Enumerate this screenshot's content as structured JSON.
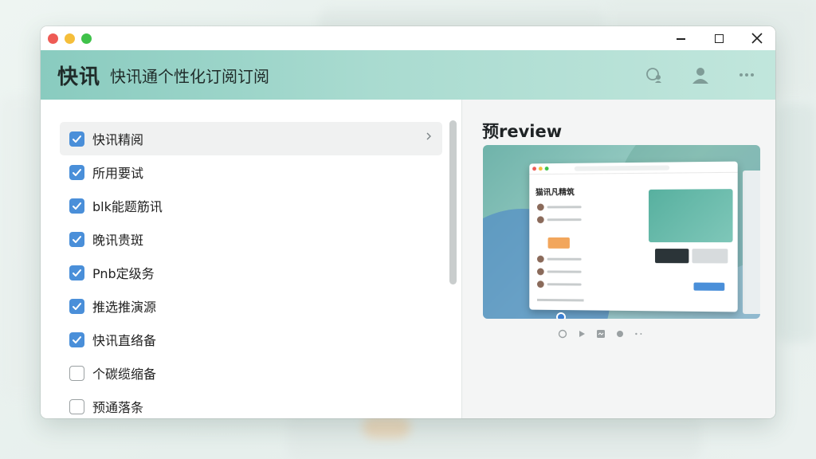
{
  "window": {
    "controls": {
      "minimize": "—",
      "maximize": "□",
      "close": "✕"
    }
  },
  "header": {
    "brand": "快讯",
    "subtitle": "快讯通个性化订阅订阅",
    "icons": [
      "search-user-icon",
      "user-icon",
      "more-icon"
    ]
  },
  "list": {
    "items": [
      {
        "label": "快讯精阅",
        "checked": true,
        "selected": true
      },
      {
        "label": "所用要试",
        "checked": true
      },
      {
        "label": "blk能题筋讯",
        "checked": true
      },
      {
        "label": "晚讯贵斑",
        "checked": true
      },
      {
        "label": "Pnb定级务",
        "checked": true
      },
      {
        "label": "推选推演源",
        "checked": true
      },
      {
        "label": "快讯直络备",
        "checked": true
      },
      {
        "label": "个碳缆缩备",
        "checked": false
      },
      {
        "label": "预通落条",
        "checked": false
      }
    ]
  },
  "preview": {
    "title": "预review",
    "mini_title": "猫讯凡精筑"
  },
  "colors": {
    "accent": "#4a8fd9",
    "header_start": "#89cbbf",
    "header_end": "#c1e6dc"
  }
}
